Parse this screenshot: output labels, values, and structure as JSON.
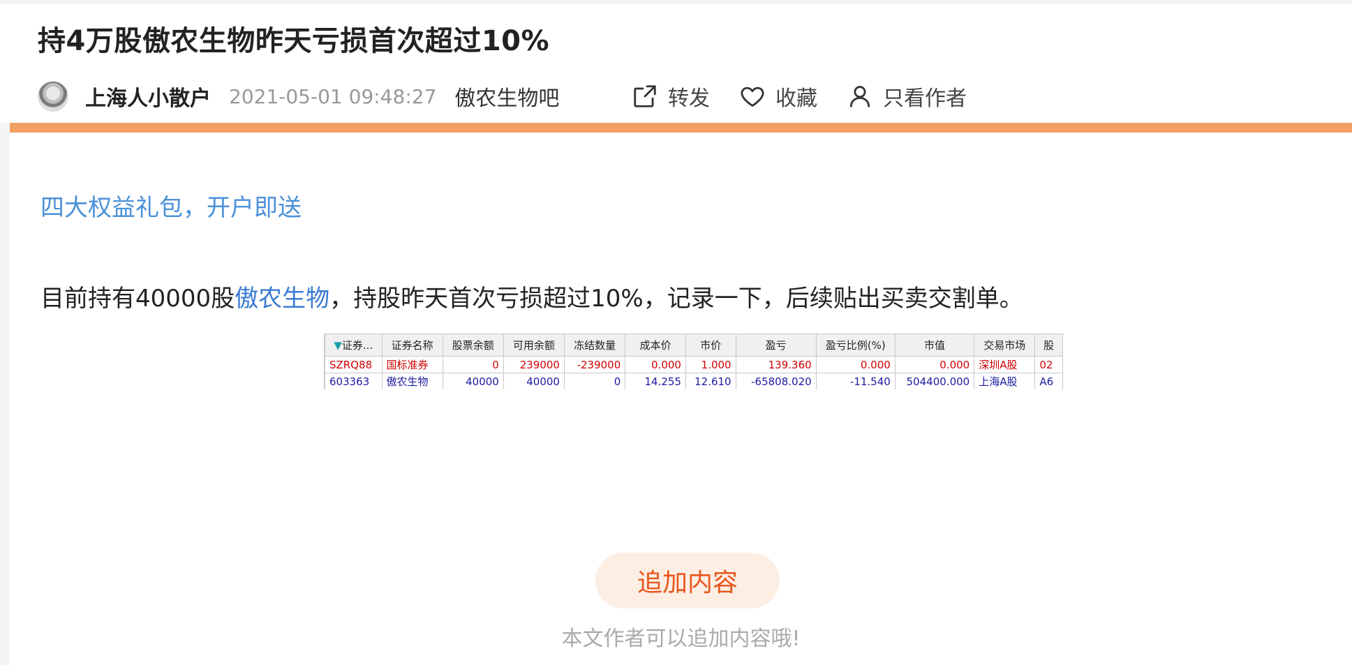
{
  "post": {
    "title": "持4万股傲农生物昨天亏损首次超过10%",
    "author": "上海人小散户",
    "time": "2021-05-01 09:48:27",
    "bar": "傲农生物吧"
  },
  "actions": {
    "forward": "转发",
    "favorite": "收藏",
    "author_only": "只看作者"
  },
  "promo": {
    "text": "四大权益礼包，开户即送"
  },
  "body": {
    "before": "目前持有40000股",
    "link": "傲农生物",
    "after": "，持股昨天首次亏损超过10%，记录一下，后续贴出买卖交割单。"
  },
  "table": {
    "headers": [
      "证券...",
      "证券名称",
      "股票余额",
      "可用余额",
      "冻结数量",
      "成本价",
      "市价",
      "盈亏",
      "盈亏比例(%)",
      "市值",
      "交易市场",
      "股"
    ],
    "rows": [
      [
        "SZRQ88",
        "国标准券",
        "0",
        "239000",
        "-239000",
        "0.000",
        "1.000",
        "139.360",
        "0.000",
        "0.000",
        "深圳A股",
        "02"
      ],
      [
        "603363",
        "傲农生物",
        "40000",
        "40000",
        "0",
        "14.255",
        "12.610",
        "-65808.020",
        "-11.540",
        "504400.000",
        "上海A股",
        "A6"
      ]
    ]
  },
  "append": {
    "button": "追加内容",
    "hint": "本文作者可以追加内容哦!"
  },
  "colors": {
    "accent": "#e8561c",
    "strip": "#f2a064",
    "link": "#3a7bd5"
  }
}
